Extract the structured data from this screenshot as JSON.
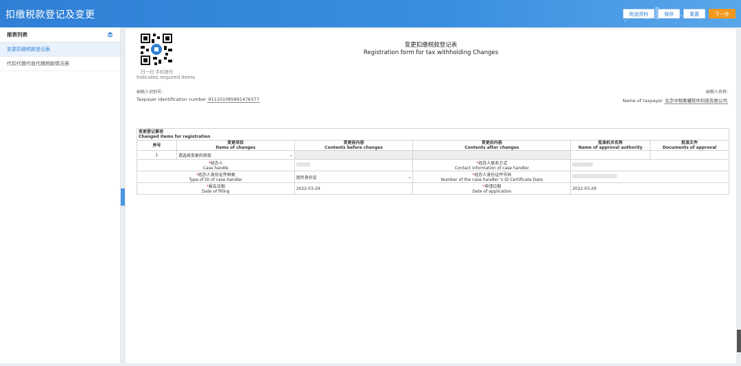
{
  "header": {
    "title": "扣缴税款登记及变更",
    "buttons": {
      "attach": "附送资料",
      "save": "保存",
      "reset": "重置",
      "next": "下一步"
    }
  },
  "sidebar": {
    "title": "报表列表",
    "items": [
      {
        "label": "变更扣缴税款登记表",
        "active": true
      },
      {
        "label": "代扣代缴代收代缴税款情况表",
        "active": false
      }
    ]
  },
  "form": {
    "qr_caption": "扫一扫 手机操作",
    "required_note": "Indicates required items",
    "title_cn": "变更扣缴税款登记表",
    "title_en": "Registration form for tax withholding Changes",
    "tin_label_cn": "纳税人识别号:",
    "tin_label_en": "Taxpayer identification number",
    "tin_value": "911101085891476377",
    "name_label_cn": "纳税人名称:",
    "name_label_en": "Name of taxpayer",
    "name_value": "北京中税筹耀软件科技有限公司"
  },
  "table": {
    "section_cn": "变更登记事项",
    "section_en": "Changed items for registration",
    "headers": [
      {
        "cn": "序号",
        "en": ""
      },
      {
        "cn": "变更项目",
        "en": "Items of changes"
      },
      {
        "cn": "变更前内容",
        "en": "Contents before changes"
      },
      {
        "cn": "变更后内容",
        "en": "Contents after changes"
      },
      {
        "cn": "批准机关名称",
        "en": "Name of approval authority"
      },
      {
        "cn": "批准文件",
        "en": "Documents of approval"
      }
    ],
    "row1": {
      "seq": "1",
      "select_placeholder": "请选择变更的项目"
    },
    "handler": {
      "star": "*",
      "cn": "经办人",
      "en": "Case handle"
    },
    "contact": {
      "star": "*",
      "cn": "经办人联系方式",
      "en": "Contact information of case handler"
    },
    "id_type": {
      "star": "*",
      "cn": "经办人身份证件种类",
      "en": "Type of ID of case handler",
      "value": "居民身份证"
    },
    "id_number": {
      "star": "*",
      "cn": "经办人身份证件号码",
      "en": "Number of the case handler 's ID Certificate Date"
    },
    "filing": {
      "star": "*",
      "cn": "报告日期",
      "en": "Date of filling",
      "value": "2022-03-29"
    },
    "application": {
      "star": "*",
      "cn": "申请日期",
      "en": "Date of application",
      "value": "2022-03-29"
    }
  }
}
